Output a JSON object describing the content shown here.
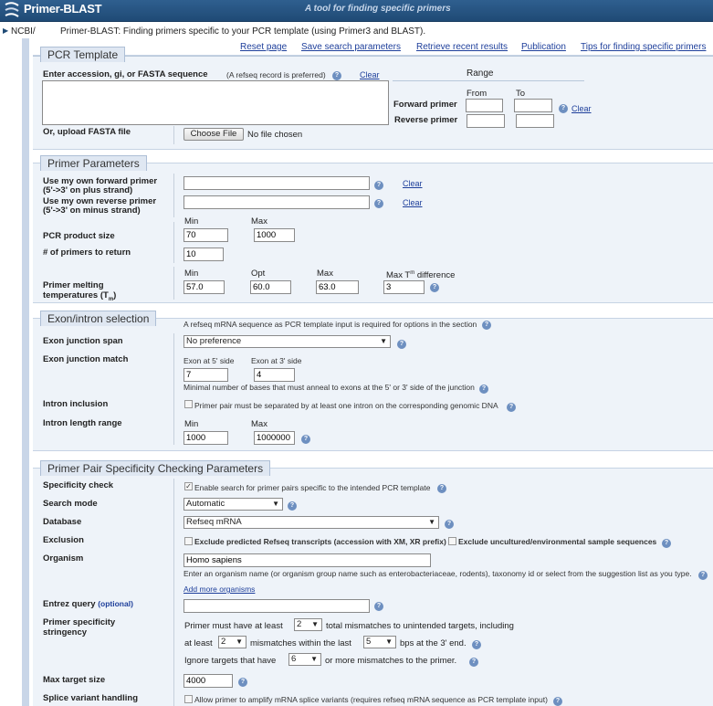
{
  "header": {
    "app_title": "Primer-BLAST",
    "tagline": "A tool for finding specific primers",
    "breadcrumb_link": "NCBI/",
    "breadcrumb_text": "Primer-BLAST: Finding primers specific to your PCR template (using Primer3 and BLAST)."
  },
  "top_links": [
    "Reset page",
    "Save search parameters",
    "Retrieve recent results",
    "Publication",
    "Tips for finding specific primers"
  ],
  "pcr_template": {
    "title": "PCR Template",
    "enter_label": "Enter accession, gi, or FASTA sequence",
    "enter_note": "(A refseq record is preferred)",
    "clear": "Clear",
    "range_label": "Range",
    "from_label": "From",
    "to_label": "To",
    "forward_label": "Forward primer",
    "reverse_label": "Reverse primer",
    "range_clear": "Clear",
    "upload_label": "Or, upload FASTA file",
    "choose_file": "Choose File",
    "no_file": "No file chosen"
  },
  "primer_params": {
    "title": "Primer Parameters",
    "fwd_label_1": "Use my own forward primer",
    "fwd_label_2": "(5'->3' on plus strand)",
    "rev_label_1": "Use my own reverse primer",
    "rev_label_2": "(5'->3' on minus strand)",
    "clear": "Clear",
    "min_label": "Min",
    "max_label": "Max",
    "product_size_label": "PCR product size",
    "product_min": "70",
    "product_max": "1000",
    "num_primers_label": "# of primers to return",
    "num_primers": "10",
    "opt_label": "Opt",
    "max_tm_diff_label": "Max T",
    "tm_sup": "m",
    "difference_label": " difference",
    "melting_label_1": "Primer melting",
    "melting_label_2": "temperatures (T",
    "melting_label_3": ")",
    "tm_min": "57.0",
    "tm_opt": "60.0",
    "tm_max": "63.0",
    "tm_diff": "3"
  },
  "exon_intron": {
    "title": "Exon/intron selection",
    "note": "A refseq mRNA sequence as PCR template input is required for options in the section",
    "span_label": "Exon junction span",
    "span_value": "No preference",
    "match_label": "Exon junction match",
    "exon5_label": "Exon at 5' side",
    "exon3_label": "Exon at 3' side",
    "exon5_value": "7",
    "exon3_value": "4",
    "match_note": "Minimal number of bases that must anneal to exons at the 5' or 3' side of the junction",
    "intron_inclusion_label": "Intron inclusion",
    "intron_inclusion_text": "Primer pair must be separated by at least one intron on the corresponding genomic DNA",
    "intron_length_label": "Intron length range",
    "min_label": "Min",
    "max_label": "Max",
    "intron_min": "1000",
    "intron_max": "1000000"
  },
  "specificity": {
    "title": "Primer Pair Specificity Checking Parameters",
    "check_label": "Specificity check",
    "check_text": "Enable search for primer pairs specific to the intended PCR template",
    "search_mode_label": "Search mode",
    "search_mode_value": "Automatic",
    "database_label": "Database",
    "database_value": "Refseq mRNA",
    "exclusion_label": "Exclusion",
    "exclusion_text_1": "Exclude predicted Refseq transcripts (accession with XM, XR prefix)",
    "exclusion_text_2": "Exclude uncultured/environmental sample sequences",
    "organism_label": "Organism",
    "organism_value": "Homo sapiens",
    "organism_note": "Enter an organism name (or organism group name such as enterobacteriaceae, rodents), taxonomy id or select from the suggestion list as you type.",
    "add_organisms": "Add more organisms",
    "entrez_label": "Entrez query",
    "entrez_optional": "(optional)",
    "stringency_label_1": "Primer specificity",
    "stringency_label_2": "stringency",
    "str_line1_a": "Primer must have at least",
    "str_line1_val": "2",
    "str_line1_b": "total mismatches to unintended targets, including",
    "str_line2_a": "at least",
    "str_line2_val": "2",
    "str_line2_b": "mismatches within the last",
    "str_line2_val2": "5",
    "str_line2_c": "bps at the 3' end.",
    "str_line3_a": "Ignore targets that have",
    "str_line3_val": "6",
    "str_line3_b": "or more mismatches to the primer.",
    "max_target_label": "Max target size",
    "max_target_value": "4000",
    "splice_label": "Splice variant handling",
    "splice_text": "Allow primer to amplify mRNA splice variants (requires refseq mRNA sequence as PCR template input)"
  },
  "colors": {
    "header_bg": "#2f5f8f",
    "section_bg": "#eef3f9",
    "link": "#1e3f9b",
    "help_icon": "#6d8fc0"
  }
}
